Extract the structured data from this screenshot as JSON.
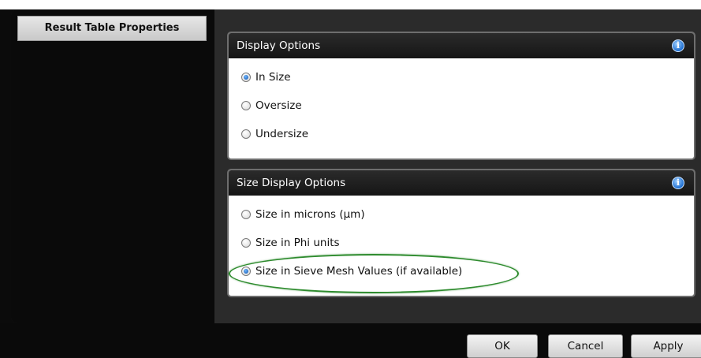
{
  "sidebar": {
    "items": [
      {
        "label": "Result Table Properties"
      }
    ]
  },
  "display_options": {
    "title": "Display Options",
    "info_icon": "info-icon",
    "options": [
      {
        "label": "In Size",
        "checked": true
      },
      {
        "label": "Oversize",
        "checked": false
      },
      {
        "label": "Undersize",
        "checked": false
      }
    ]
  },
  "size_display_options": {
    "title": "Size Display Options",
    "info_icon": "info-icon",
    "options": [
      {
        "label": "Size in microns (µm)",
        "checked": false
      },
      {
        "label": "Size in Phi units",
        "checked": false
      },
      {
        "label": "Size in Sieve Mesh Values (if available)",
        "checked": true
      }
    ]
  },
  "footer": {
    "ok_label": "OK",
    "cancel_label": "Cancel",
    "apply_label": "Apply"
  },
  "colors": {
    "annotation_ellipse": "#2e8b2e",
    "info_icon": "#1f6fd1",
    "header_bg": "#1a1a1a"
  }
}
